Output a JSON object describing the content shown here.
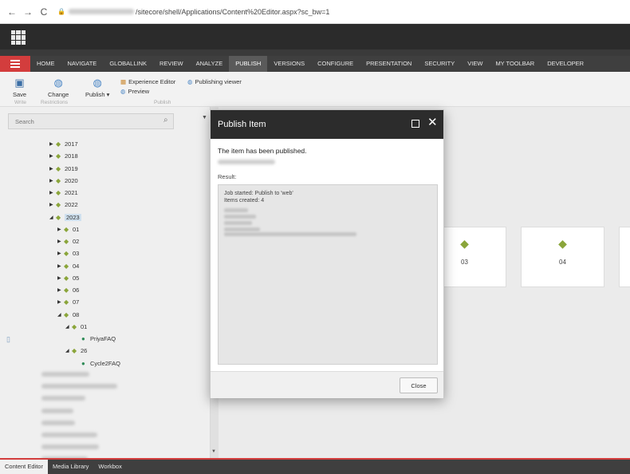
{
  "browser": {
    "back_glyph": "←",
    "forward_glyph": "→",
    "reload_glyph": "C",
    "url_path": "/sitecore/shell/Applications/Content%20Editor.aspx?sc_bw=1"
  },
  "ribbon": {
    "tabs": [
      "HOME",
      "NAVIGATE",
      "GLOBALLINK",
      "REVIEW",
      "ANALYZE",
      "PUBLISH",
      "VERSIONS",
      "CONFIGURE",
      "PRESENTATION",
      "SECURITY",
      "VIEW",
      "MY TOOLBAR",
      "DEVELOPER"
    ],
    "active_tab": "PUBLISH",
    "save_label": "Save",
    "change_label": "Change",
    "publish_label": "Publish ▾",
    "experience_editor_label": "Experience Editor",
    "preview_label": "Preview",
    "publishing_viewer_label": "Publishing viewer",
    "group_write": "Write",
    "group_restrictions": "Restrictions",
    "group_publish": "Publish"
  },
  "search": {
    "placeholder": "Search"
  },
  "tree": {
    "years": [
      "2017",
      "2018",
      "2019",
      "2020",
      "2021",
      "2022"
    ],
    "selected_year": "2023",
    "months": [
      "01",
      "02",
      "03",
      "04",
      "05",
      "06",
      "07"
    ],
    "open_month": "08",
    "sub_folder_1": "01",
    "item_1": "PriyaFAQ",
    "sub_folder_2": "26",
    "item_2": "Cycle2FAQ"
  },
  "tiles": [
    "03",
    "04"
  ],
  "bottom_tabs": [
    "Content Editor",
    "Media Library",
    "Workbox"
  ],
  "dialog": {
    "title": "Publish Item",
    "message": "The item has been published.",
    "result_label": "Result:",
    "result_lines": [
      "Job started: Publish to 'web'",
      "Items created: 4"
    ],
    "close_button": "Close",
    "close_glyph": "✕"
  },
  "colors": {
    "accent_red": "#d33d3d",
    "header_dark": "#2c2c2c",
    "folder_green": "#8aa53a"
  }
}
